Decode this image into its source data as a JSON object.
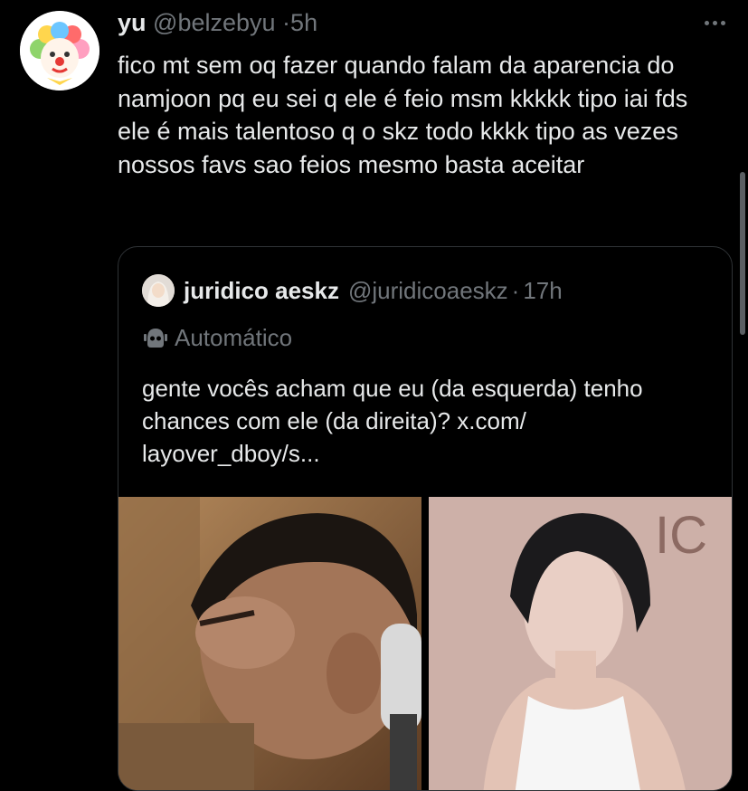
{
  "tweet": {
    "author_name": "yu",
    "author_handle": "@belzebyu",
    "separator": "·",
    "time": "5h",
    "text": "fico mt sem oq fazer quando falam da aparencia do namjoon pq eu sei q ele é feio msm kkkkk tipo iai fds ele é mais talentoso q o skz todo kkkk tipo as vezes nossos favs sao feios mesmo basta aceitar",
    "more_icon": "more-horizontal-icon"
  },
  "quote": {
    "author_name": "juridico aeskz",
    "author_handle": "@juridicoaeskz",
    "separator": "·",
    "time": "17h",
    "automated_label": "Automático",
    "automated_icon": "robot-icon",
    "text": "gente vocês acham que eu (da esquerda) tenho chances com ele (da direita)? x.com/ layover_dboy/s..."
  },
  "colors": {
    "background": "#000000",
    "text_primary": "#e7e9ea",
    "text_muted": "#71767b",
    "border": "#2f3336"
  }
}
